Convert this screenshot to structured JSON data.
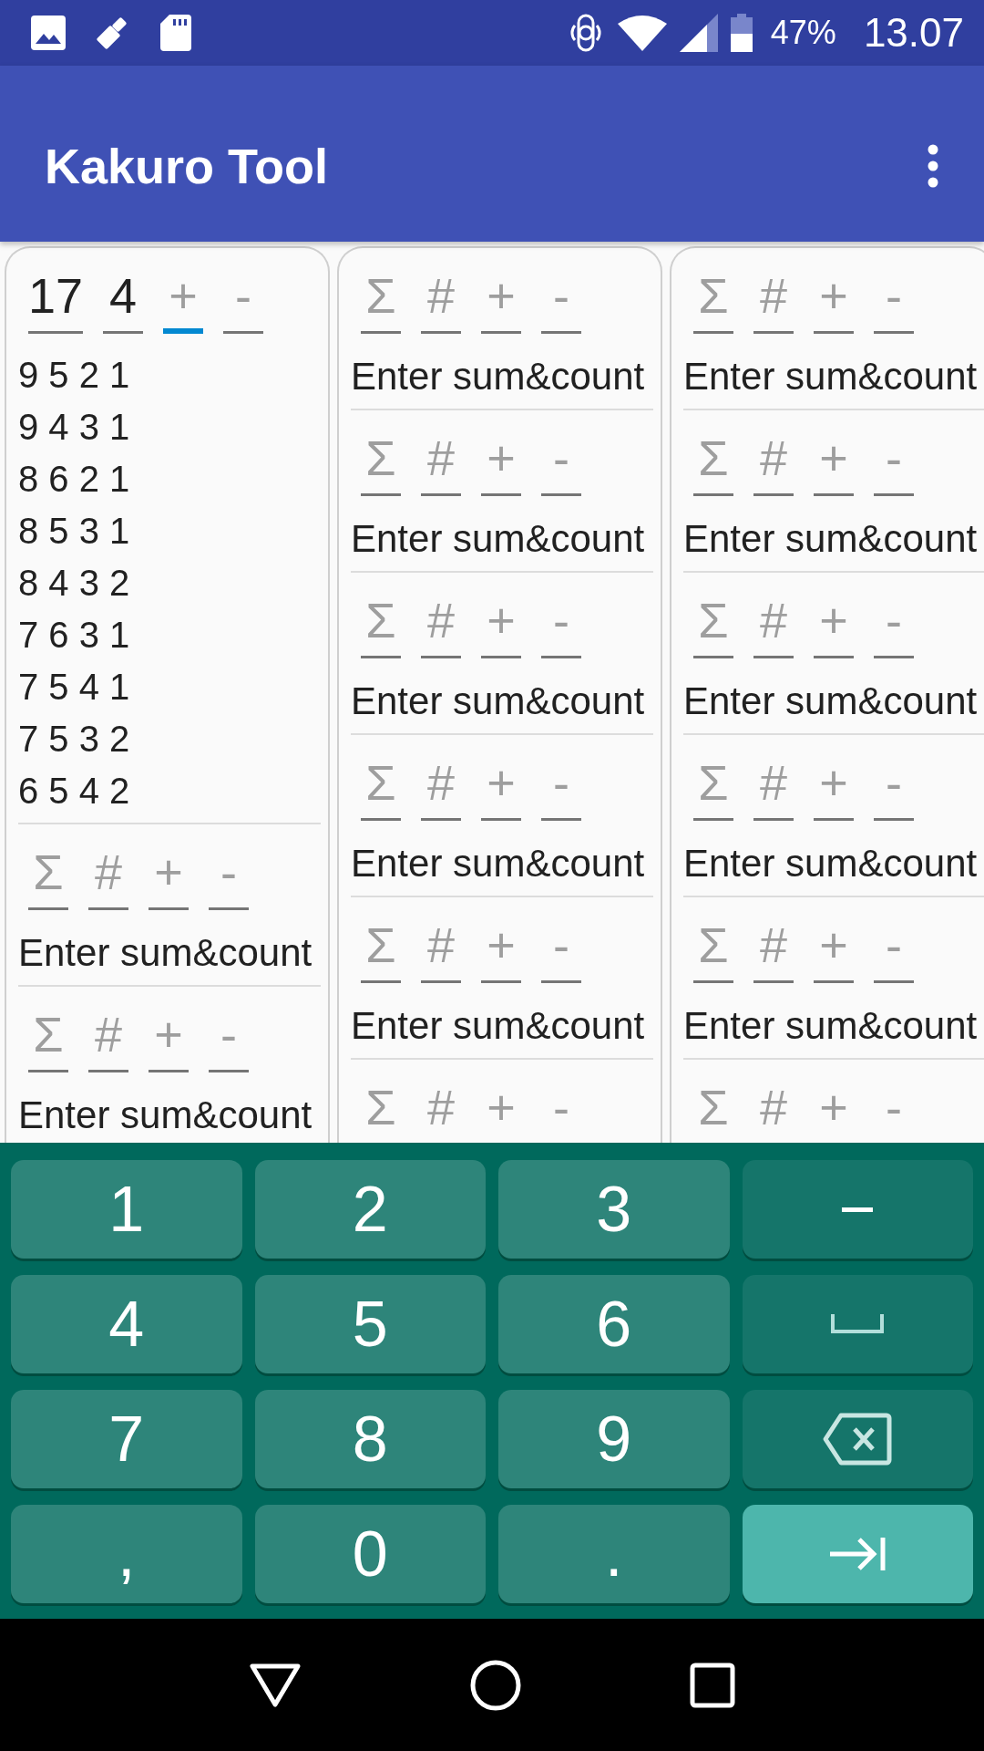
{
  "status_bar": {
    "battery": "47%",
    "time": "13.07"
  },
  "app_bar": {
    "title": "Kakuro Tool"
  },
  "columns": [
    {
      "blocks": [
        {
          "fields": [
            {
              "value": "17",
              "focused": false
            },
            {
              "value": "4",
              "focused": false
            },
            {
              "placeholder": "+",
              "focused": true
            },
            {
              "placeholder": "-",
              "focused": false
            }
          ],
          "output": {
            "kind": "combos",
            "lines": [
              "9 5 2 1",
              "9 4 3 1",
              "8 6 2 1",
              "8 5 3 1",
              "8 4 3 2",
              "7 6 3 1",
              "7 5 4 1",
              "7 5 3 2",
              "6 5 4 2"
            ]
          }
        },
        {
          "fields": [
            {
              "placeholder": "Σ",
              "focused": false
            },
            {
              "placeholder": "#",
              "focused": false
            },
            {
              "placeholder": "+",
              "focused": false
            },
            {
              "placeholder": "-",
              "focused": false
            }
          ],
          "output": {
            "kind": "message",
            "text": "Enter sum&count"
          }
        },
        {
          "fields": [
            {
              "placeholder": "Σ",
              "focused": false
            },
            {
              "placeholder": "#",
              "focused": false
            },
            {
              "placeholder": "+",
              "focused": false
            },
            {
              "placeholder": "-",
              "focused": false
            }
          ],
          "output": {
            "kind": "message",
            "text": "Enter sum&count"
          }
        }
      ]
    },
    {
      "blocks": [
        {
          "fields": [
            {
              "placeholder": "Σ",
              "focused": false
            },
            {
              "placeholder": "#",
              "focused": false
            },
            {
              "placeholder": "+",
              "focused": false
            },
            {
              "placeholder": "-",
              "focused": false
            }
          ],
          "output": {
            "kind": "message",
            "text": "Enter sum&count"
          }
        },
        {
          "fields": [
            {
              "placeholder": "Σ",
              "focused": false
            },
            {
              "placeholder": "#",
              "focused": false
            },
            {
              "placeholder": "+",
              "focused": false
            },
            {
              "placeholder": "-",
              "focused": false
            }
          ],
          "output": {
            "kind": "message",
            "text": "Enter sum&count"
          }
        },
        {
          "fields": [
            {
              "placeholder": "Σ",
              "focused": false
            },
            {
              "placeholder": "#",
              "focused": false
            },
            {
              "placeholder": "+",
              "focused": false
            },
            {
              "placeholder": "-",
              "focused": false
            }
          ],
          "output": {
            "kind": "message",
            "text": "Enter sum&count"
          }
        },
        {
          "fields": [
            {
              "placeholder": "Σ",
              "focused": false
            },
            {
              "placeholder": "#",
              "focused": false
            },
            {
              "placeholder": "+",
              "focused": false
            },
            {
              "placeholder": "-",
              "focused": false
            }
          ],
          "output": {
            "kind": "message",
            "text": "Enter sum&count"
          }
        },
        {
          "fields": [
            {
              "placeholder": "Σ",
              "focused": false
            },
            {
              "placeholder": "#",
              "focused": false
            },
            {
              "placeholder": "+",
              "focused": false
            },
            {
              "placeholder": "-",
              "focused": false
            }
          ],
          "output": {
            "kind": "message",
            "text": "Enter sum&count"
          }
        },
        {
          "fields": [
            {
              "placeholder": "Σ",
              "focused": false
            },
            {
              "placeholder": "#",
              "focused": false
            },
            {
              "placeholder": "+",
              "focused": false
            },
            {
              "placeholder": "-",
              "focused": false
            }
          ]
        }
      ]
    },
    {
      "blocks": [
        {
          "fields": [
            {
              "placeholder": "Σ",
              "focused": false
            },
            {
              "placeholder": "#",
              "focused": false
            },
            {
              "placeholder": "+",
              "focused": false
            },
            {
              "placeholder": "-",
              "focused": false
            }
          ],
          "output": {
            "kind": "message",
            "text": "Enter sum&count"
          }
        },
        {
          "fields": [
            {
              "placeholder": "Σ",
              "focused": false
            },
            {
              "placeholder": "#",
              "focused": false
            },
            {
              "placeholder": "+",
              "focused": false
            },
            {
              "placeholder": "-",
              "focused": false
            }
          ],
          "output": {
            "kind": "message",
            "text": "Enter sum&count"
          }
        },
        {
          "fields": [
            {
              "placeholder": "Σ",
              "focused": false
            },
            {
              "placeholder": "#",
              "focused": false
            },
            {
              "placeholder": "+",
              "focused": false
            },
            {
              "placeholder": "-",
              "focused": false
            }
          ],
          "output": {
            "kind": "message",
            "text": "Enter sum&count"
          }
        },
        {
          "fields": [
            {
              "placeholder": "Σ",
              "focused": false
            },
            {
              "placeholder": "#",
              "focused": false
            },
            {
              "placeholder": "+",
              "focused": false
            },
            {
              "placeholder": "-",
              "focused": false
            }
          ],
          "output": {
            "kind": "message",
            "text": "Enter sum&count"
          }
        },
        {
          "fields": [
            {
              "placeholder": "Σ",
              "focused": false
            },
            {
              "placeholder": "#",
              "focused": false
            },
            {
              "placeholder": "+",
              "focused": false
            },
            {
              "placeholder": "-",
              "focused": false
            }
          ],
          "output": {
            "kind": "message",
            "text": "Enter sum&count"
          }
        },
        {
          "fields": [
            {
              "placeholder": "Σ",
              "focused": false
            },
            {
              "placeholder": "#",
              "focused": false
            },
            {
              "placeholder": "+",
              "focused": false
            },
            {
              "placeholder": "-",
              "focused": false
            }
          ]
        }
      ]
    }
  ],
  "keyboard": {
    "keys": [
      {
        "kind": "digit",
        "label": "1"
      },
      {
        "kind": "digit",
        "label": "2"
      },
      {
        "kind": "digit",
        "label": "3"
      },
      {
        "kind": "function",
        "label": "−"
      },
      {
        "kind": "digit",
        "label": "4"
      },
      {
        "kind": "digit",
        "label": "5"
      },
      {
        "kind": "digit",
        "label": "6"
      },
      {
        "kind": "space"
      },
      {
        "kind": "digit",
        "label": "7"
      },
      {
        "kind": "digit",
        "label": "8"
      },
      {
        "kind": "digit",
        "label": "9"
      },
      {
        "kind": "backspace"
      },
      {
        "kind": "digit",
        "label": ","
      },
      {
        "kind": "digit",
        "label": "0"
      },
      {
        "kind": "digit",
        "label": "."
      },
      {
        "kind": "next"
      }
    ]
  }
}
